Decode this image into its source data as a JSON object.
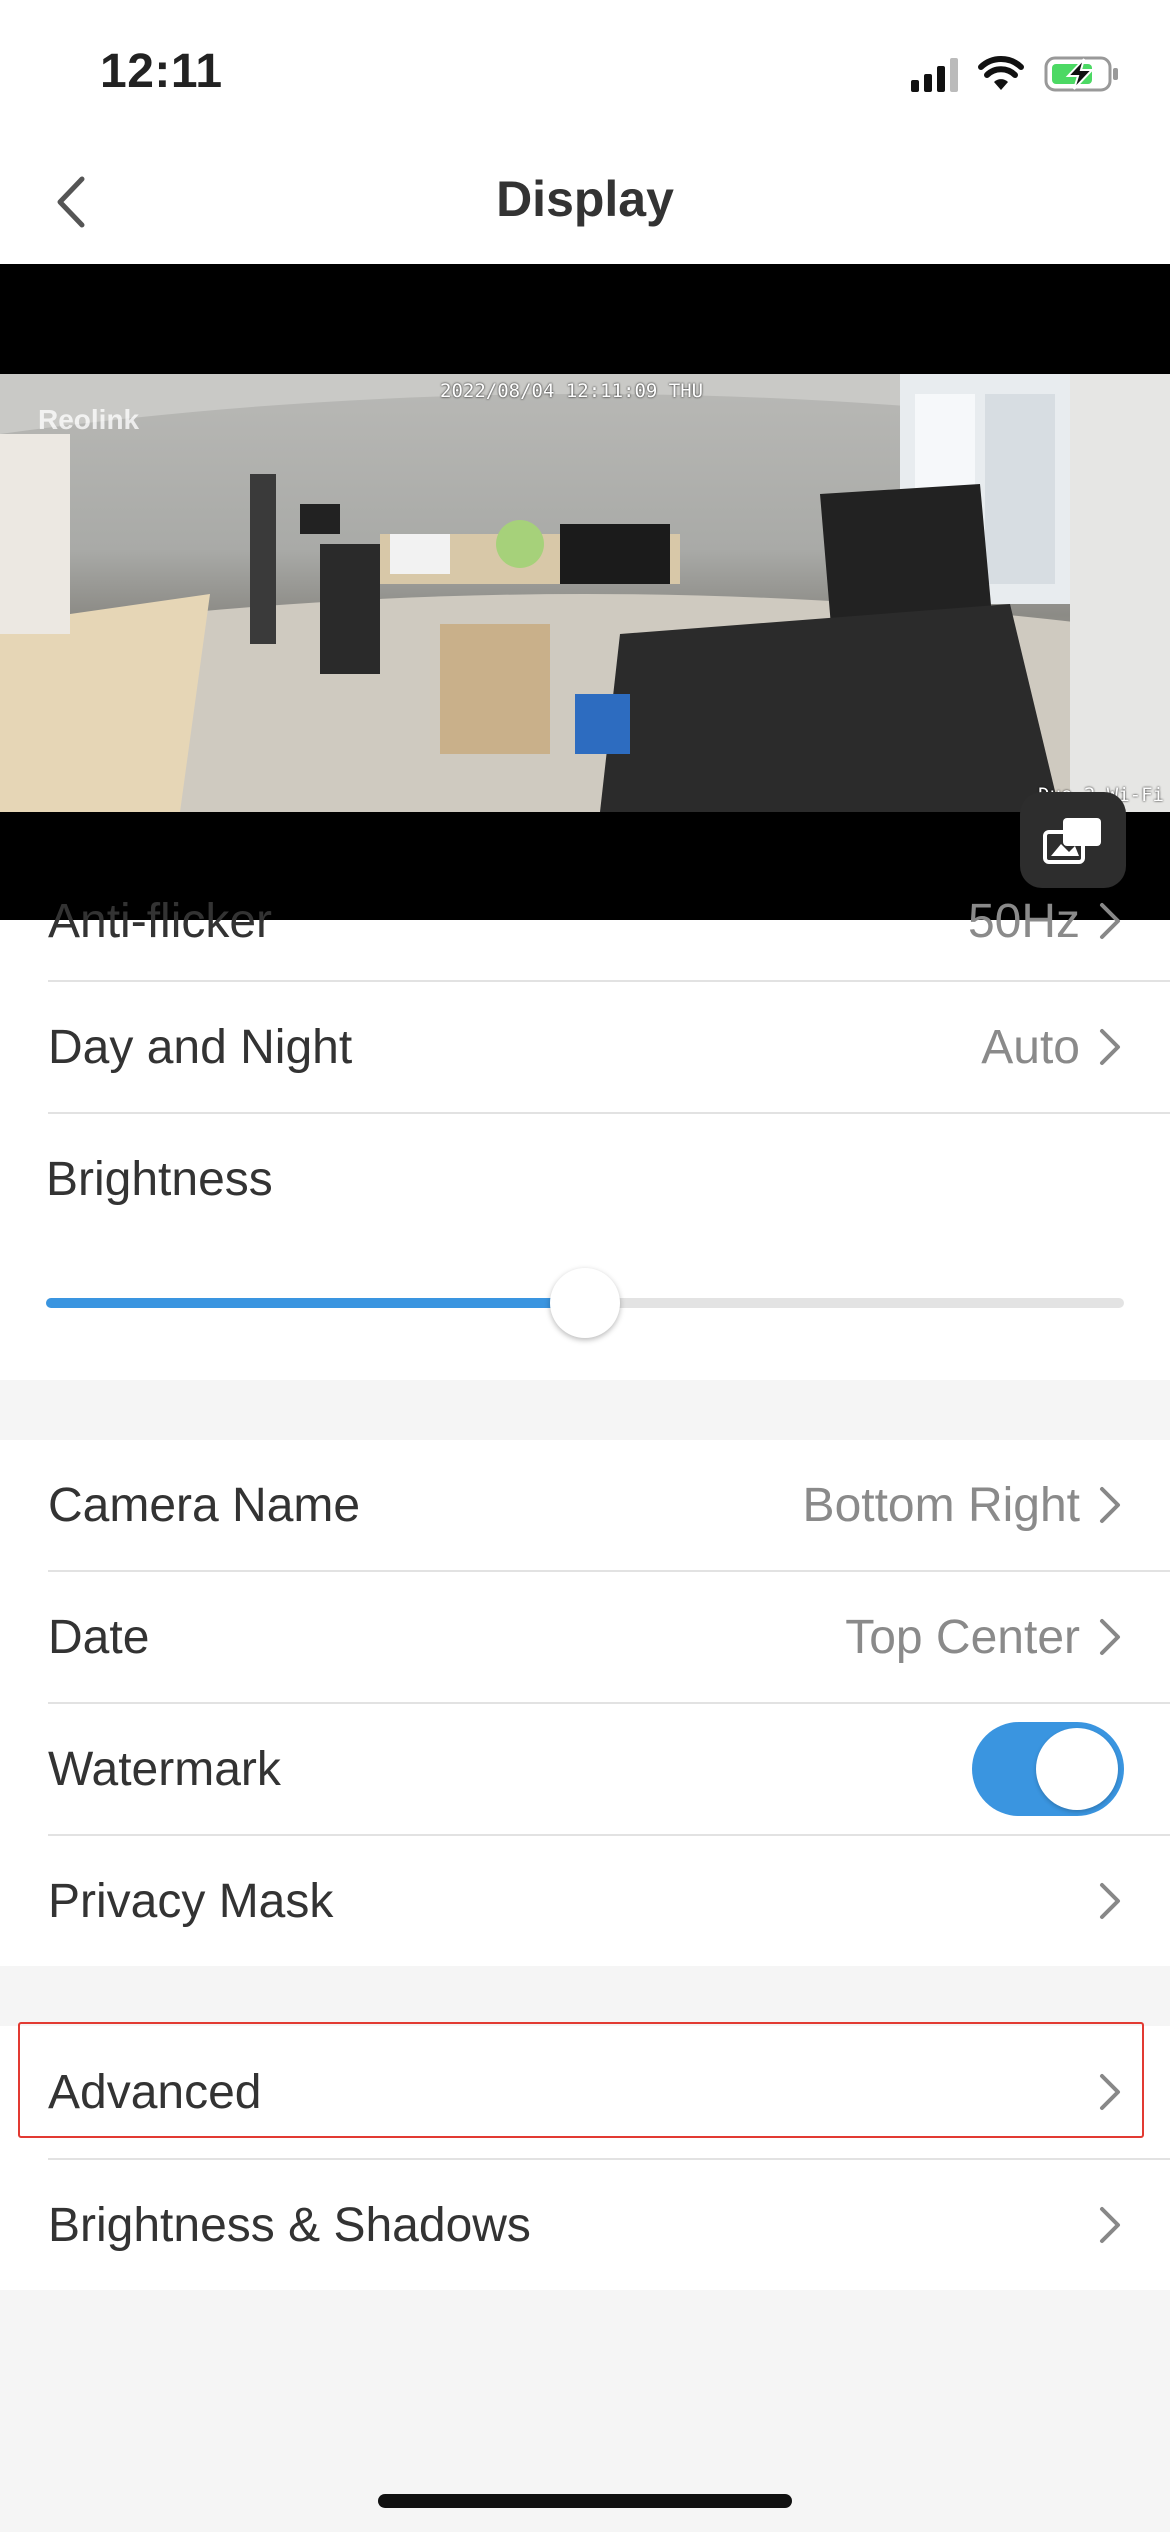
{
  "status_bar": {
    "time": "12:11",
    "icons": [
      "signal-icon",
      "wifi-icon",
      "battery-charging-icon"
    ]
  },
  "nav": {
    "title": "Display",
    "back_icon": "chevron-left-icon"
  },
  "video": {
    "date_overlay": "2022/08/04 12:11:09 THU",
    "name_overlay": "Duo 2 Wi-Fi",
    "watermark_text": "Reolink",
    "pip_icon": "picture-in-picture-icon"
  },
  "settings": {
    "anti_flicker": {
      "label": "Anti-flicker",
      "value": "50Hz"
    },
    "day_night": {
      "label": "Day and Night",
      "value": "Auto"
    },
    "brightness": {
      "label": "Brightness",
      "level": 0.5
    },
    "camera_name": {
      "label": "Camera Name",
      "value": "Bottom Right"
    },
    "date": {
      "label": "Date",
      "value": "Top Center"
    },
    "watermark": {
      "label": "Watermark",
      "on": true
    },
    "privacy_mask": {
      "label": "Privacy Mask"
    },
    "advanced": {
      "label": "Advanced"
    },
    "brightness_shadows": {
      "label": "Brightness & Shadows"
    }
  },
  "colors": {
    "accent": "#3a95e0",
    "highlight": "#e23a32"
  }
}
